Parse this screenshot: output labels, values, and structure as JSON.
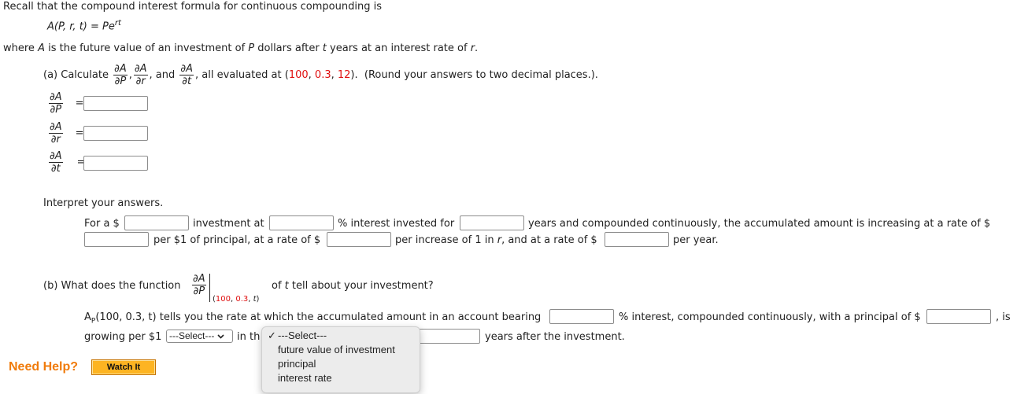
{
  "intro": {
    "line1": "Recall that the compound interest formula for continuous compounding is",
    "formula_lhs": "A(P, r, t) = Pe",
    "formula_exp": "rt",
    "line3_pre": "where ",
    "line3_A": "A",
    "line3_mid1": " is the future value of an investment of ",
    "line3_P": "P",
    "line3_mid2": " dollars after ",
    "line3_t": "t",
    "line3_mid3": " years at an interest rate of ",
    "line3_r": "r",
    "line3_end": "."
  },
  "part_a": {
    "prefix": "(a) Calculate",
    "frac_num": "∂A",
    "frac_den_P": "∂P",
    "frac_den_r": "∂r",
    "frac_den_t": "∂t",
    "comma": ",",
    "and": "and",
    "mid": ", all evaluated at (",
    "p1": "100",
    "sep": ", ",
    "p2": "0.3",
    "p3": "12",
    "suffix": ").  (Round your answers to two decimal places.).",
    "equals": "=",
    "answers": {
      "dP": "",
      "dr": "",
      "dt": ""
    }
  },
  "interpret": {
    "heading": "Interpret your answers.",
    "s1": "For a $",
    "s2": "investment at",
    "s3": "% interest invested for",
    "s4": "years and compounded continuously, the accumulated amount is increasing at a rate of $",
    "s5": "per $1 of principal, at a rate of $",
    "s6_pre": "per increase of 1 in ",
    "s6_r": "r",
    "s6_post": ", and at a rate of $",
    "s7": "per year.",
    "values": {
      "investment": "",
      "interest": "",
      "years": "",
      "rate_principal": "",
      "rate_r": "",
      "rate_year": ""
    }
  },
  "part_b": {
    "prefix": "(b) What does the function",
    "frac_num": "∂A",
    "frac_den": "∂P",
    "eval_open": "(",
    "eval_p1": "100",
    "eval_sep": ", ",
    "eval_p2": "0.3",
    "eval_t": "t",
    "eval_close": ")",
    "suffix_pre": "of ",
    "suffix_t": "t",
    "suffix_post": " tell about your investment?",
    "line1_A": "A",
    "line1_sub": "P",
    "line1_rest": "(100, 0.3, t) tells you the rate at which the accumulated amount in an account bearing",
    "line1_mid": "% interest, compounded continuously, with a principal of $",
    "line1_end": ", is",
    "line2_pre": "growing per $1",
    "line2_in": "in th",
    "line2_end": "years after the investment.",
    "select_value": "---Select---",
    "dropdown_options": [
      "---Select---",
      "future value of investment",
      "principal",
      "interest rate"
    ],
    "dropdown_selected_index": 0,
    "check_mark": "✓",
    "values": {
      "interest": "",
      "principal": "",
      "years": ""
    }
  },
  "help": {
    "label": "Need Help?",
    "watch_button": "Watch It"
  },
  "colors": {
    "highlight_red": "#e01010",
    "help_orange": "#f07b0b",
    "watch_button_bg": "#fdb422"
  }
}
